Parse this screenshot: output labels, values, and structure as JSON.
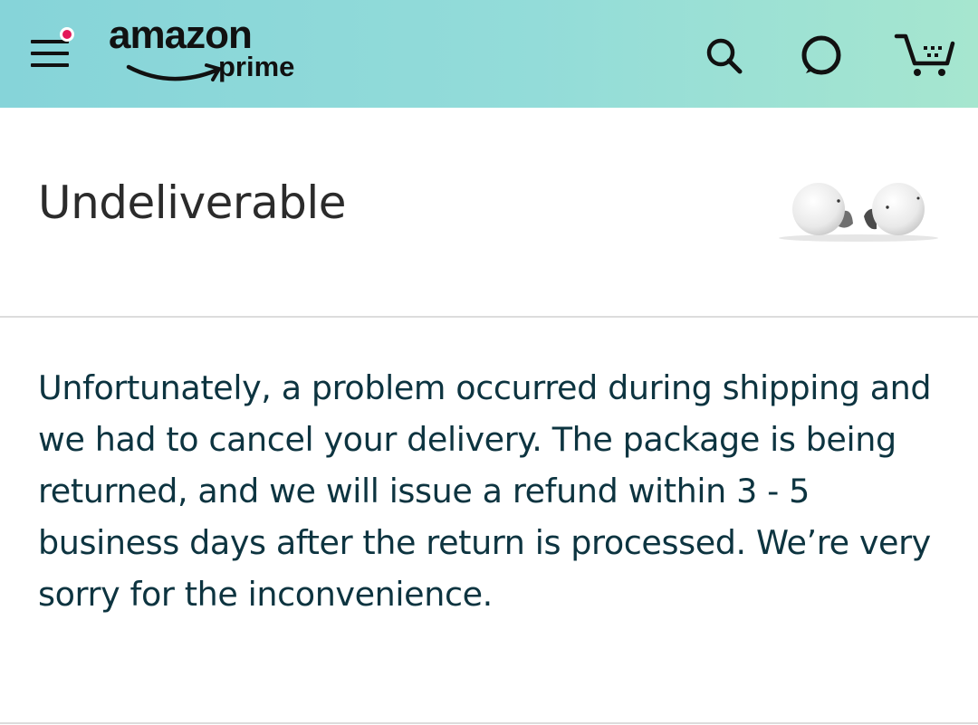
{
  "header": {
    "logo_word": "amazon",
    "logo_sub": "prime",
    "menu_icon": "hamburger-menu-icon",
    "notification_badge_color": "#e3185a",
    "search_icon": "search-icon",
    "alexa_icon": "alexa-ring-icon",
    "cart_icon": "cart-icon",
    "gradient_colors": [
      "#86d4d9",
      "#a6e6cf"
    ]
  },
  "main": {
    "title": "Undeliverable",
    "product_image": "white-earbuds-image",
    "message": "Unfortunately, a problem occurred during shipping and we had to cancel your delivery. The package is being returned, and we will issue a refund within 3 - 5 business days after the return is processed. We’re very sorry for the inconvenience."
  }
}
